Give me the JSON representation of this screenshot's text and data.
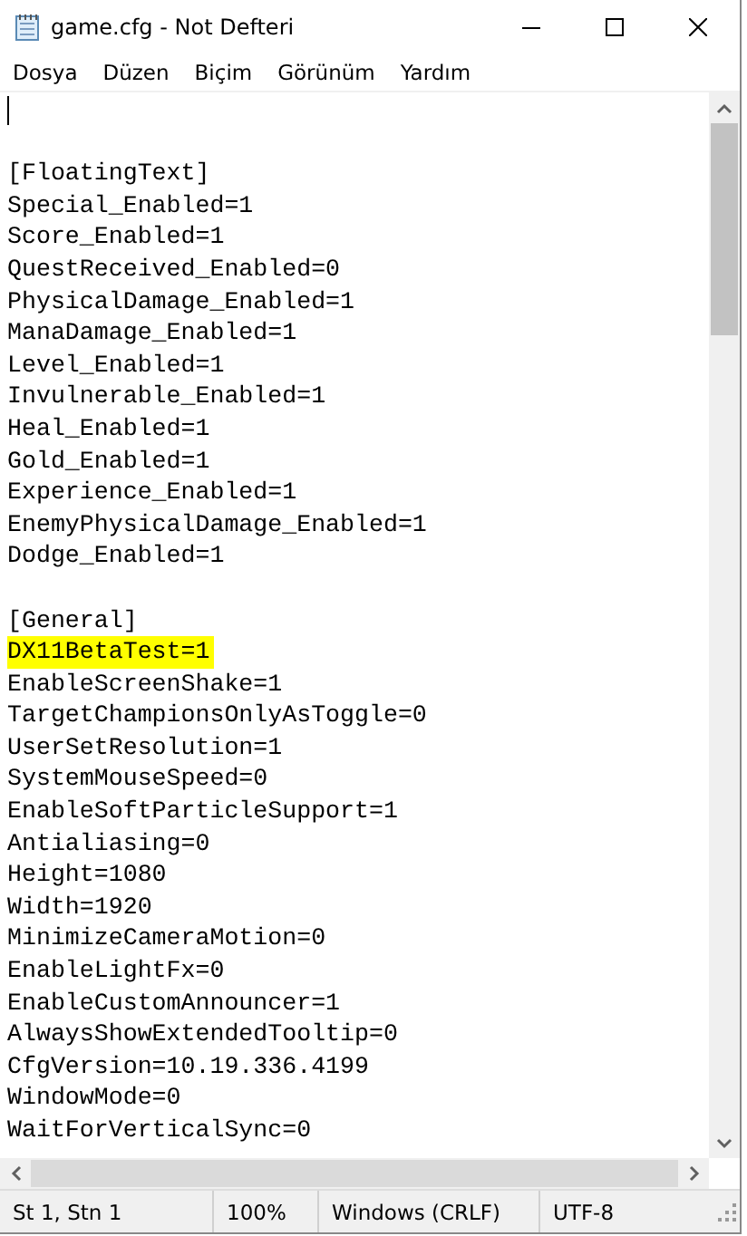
{
  "window": {
    "title": "game.cfg - Not Defteri"
  },
  "menu": [
    "Dosya",
    "Düzen",
    "Biçim",
    "Görünüm",
    "Yardım"
  ],
  "editor": {
    "lines": [
      {
        "highlighted": false,
        "cursor": true
      },
      {
        "highlighted": false,
        "cursor": false
      },
      {
        "text": "[FloatingText]",
        "highlighted": false,
        "cursor": false
      },
      {
        "text": "Special_Enabled=1",
        "highlighted": false,
        "cursor": false
      },
      {
        "text": "Score_Enabled=1",
        "highlighted": false,
        "cursor": false
      },
      {
        "text": "QuestReceived_Enabled=0",
        "highlighted": false,
        "cursor": false
      },
      {
        "text": "PhysicalDamage_Enabled=1",
        "highlighted": false,
        "cursor": false
      },
      {
        "text": "ManaDamage_Enabled=1",
        "highlighted": false,
        "cursor": false
      },
      {
        "text": "Level_Enabled=1",
        "highlighted": false,
        "cursor": false
      },
      {
        "text": "Invulnerable_Enabled=1",
        "highlighted": false,
        "cursor": false
      },
      {
        "text": "Heal_Enabled=1",
        "highlighted": false,
        "cursor": false
      },
      {
        "text": "Gold_Enabled=1",
        "highlighted": false,
        "cursor": false
      },
      {
        "text": "Experience_Enabled=1",
        "highlighted": false,
        "cursor": false
      },
      {
        "text": "EnemyPhysicalDamage_Enabled=1",
        "highlighted": false,
        "cursor": false
      },
      {
        "text": "Dodge_Enabled=1",
        "highlighted": false,
        "cursor": false
      },
      {
        "highlighted": false,
        "cursor": false
      },
      {
        "text": "[General]",
        "highlighted": false,
        "cursor": false
      },
      {
        "text": "DX11BetaTest=1",
        "highlighted": true,
        "cursor": false
      },
      {
        "text": "EnableScreenShake=1",
        "highlighted": false,
        "cursor": false
      },
      {
        "text": "TargetChampionsOnlyAsToggle=0",
        "highlighted": false,
        "cursor": false
      },
      {
        "text": "UserSetResolution=1",
        "highlighted": false,
        "cursor": false
      },
      {
        "text": "SystemMouseSpeed=0",
        "highlighted": false,
        "cursor": false
      },
      {
        "text": "EnableSoftParticleSupport=1",
        "highlighted": false,
        "cursor": false
      },
      {
        "text": "Antialiasing=0",
        "highlighted": false,
        "cursor": false
      },
      {
        "text": "Height=1080",
        "highlighted": false,
        "cursor": false
      },
      {
        "text": "Width=1920",
        "highlighted": false,
        "cursor": false
      },
      {
        "text": "MinimizeCameraMotion=0",
        "highlighted": false,
        "cursor": false
      },
      {
        "text": "EnableLightFx=0",
        "highlighted": false,
        "cursor": false
      },
      {
        "text": "EnableCustomAnnouncer=1",
        "highlighted": false,
        "cursor": false
      },
      {
        "text": "AlwaysShowExtendedTooltip=0",
        "highlighted": false,
        "cursor": false
      },
      {
        "text": "CfgVersion=10.19.336.4199",
        "highlighted": false,
        "cursor": false
      },
      {
        "text": "WindowMode=0",
        "highlighted": false,
        "cursor": false
      },
      {
        "text": "WaitForVerticalSync=0",
        "highlighted": false,
        "cursor": false
      }
    ]
  },
  "status_bar": [
    "St 1, Stn 1",
    "100%",
    "Windows (CRLF)",
    "UTF-8"
  ]
}
